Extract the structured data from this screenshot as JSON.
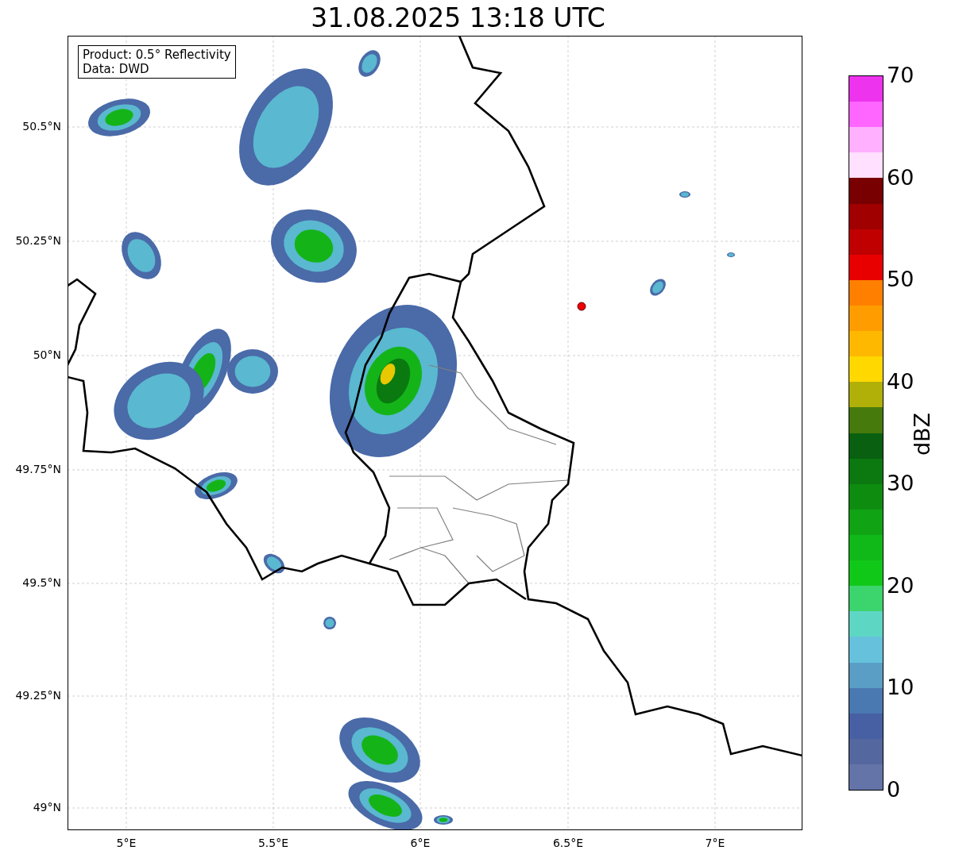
{
  "title": "31.08.2025 13:18 UTC",
  "info_box": {
    "lines": [
      "Product: 0.5° Reflectivity",
      "Data: DWD"
    ]
  },
  "map": {
    "y_ticks": [
      "50.5°N",
      "50.25°N",
      "50°N",
      "49.75°N",
      "49.5°N",
      "49.25°N",
      "49°N"
    ],
    "x_ticks": [
      "5°E",
      "5.5°E",
      "6°E",
      "6.5°E",
      "7°E"
    ]
  },
  "colorbar": {
    "label": "dBZ",
    "ticks": [
      "70",
      "60",
      "50",
      "40",
      "30",
      "20",
      "10",
      "0"
    ],
    "bins": [
      {
        "color": "#ee33ee"
      },
      {
        "color": "#ff66ff"
      },
      {
        "color": "#ffb0ff"
      },
      {
        "color": "#ffe0ff"
      },
      {
        "color": "#780000"
      },
      {
        "color": "#a00000"
      },
      {
        "color": "#c00000"
      },
      {
        "color": "#e80000"
      },
      {
        "color": "#ff8000"
      },
      {
        "color": "#ff9c00"
      },
      {
        "color": "#ffb800"
      },
      {
        "color": "#ffd800"
      },
      {
        "color": "#b0b008"
      },
      {
        "color": "#467a0c"
      },
      {
        "color": "#086010"
      },
      {
        "color": "#0c7810"
      },
      {
        "color": "#0e8c10"
      },
      {
        "color": "#10a414"
      },
      {
        "color": "#10b818"
      },
      {
        "color": "#10c818"
      },
      {
        "color": "#3cd46c"
      },
      {
        "color": "#5ed6c4"
      },
      {
        "color": "#66c2dc"
      },
      {
        "color": "#5a9ec6"
      },
      {
        "color": "#4a78b0"
      },
      {
        "color": "#4660a3"
      },
      {
        "color": "#54689f"
      },
      {
        "color": "#6474a8"
      }
    ]
  }
}
